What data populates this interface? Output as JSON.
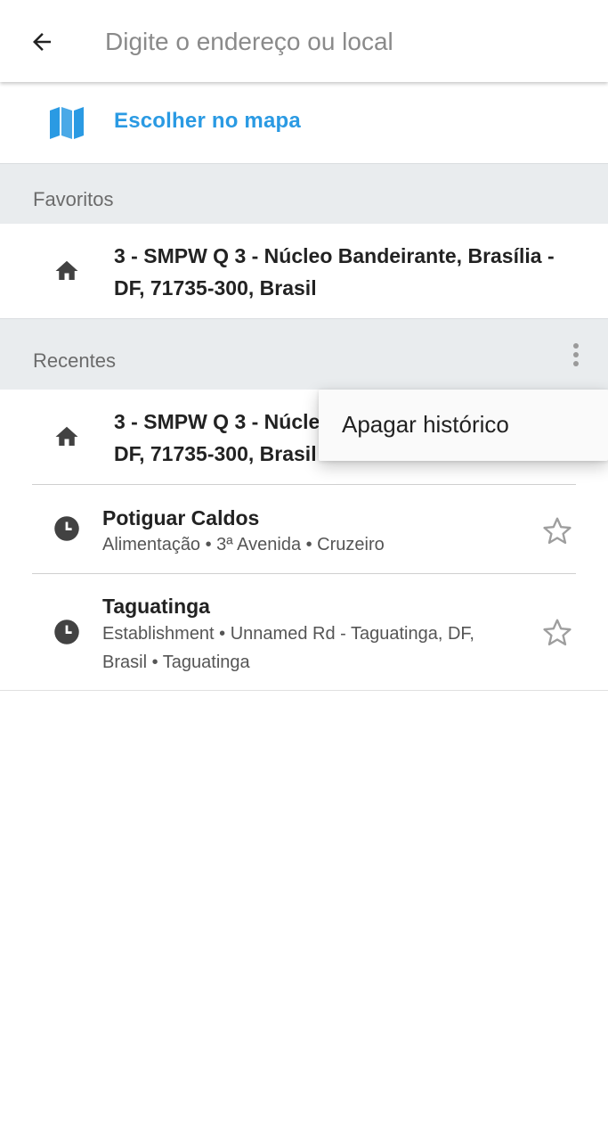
{
  "search": {
    "placeholder": "Digite o endereço ou local",
    "value": ""
  },
  "icons": {
    "back": "arrow-left-icon",
    "map": "map-icon",
    "home": "home-icon",
    "history": "clock-icon",
    "favorite": "star-outline-icon",
    "more": "more-vert-icon"
  },
  "colors": {
    "accent": "#2a9ae3",
    "section_bg": "#e9ecee",
    "icon_dark": "#424242",
    "star_gray": "#9e9e9e"
  },
  "pick_on_map": {
    "label": "Escolher no mapa"
  },
  "favorites": {
    "title": "Favoritos",
    "items": [
      {
        "line1": "3 - SMPW Q 3 - Núcleo Bandeirante, Brasília -",
        "line2": "DF, 71735-300, Brasil"
      }
    ]
  },
  "recents": {
    "title": "Recentes",
    "items": [
      {
        "line1": "3 - SMPW Q 3 - Núcle",
        "line2": "DF, 71735-300, Brasil"
      },
      {
        "title": "Potiguar Caldos",
        "subtitle": "Alimentação • 3ª Avenida • Cruzeiro"
      },
      {
        "title": "Taguatinga",
        "subtitle_line1": "Establishment • Unnamed Rd - Taguatinga, DF,",
        "subtitle_line2": "Brasil • Taguatinga"
      }
    ]
  },
  "menu": {
    "items": [
      "Apagar histórico"
    ]
  }
}
